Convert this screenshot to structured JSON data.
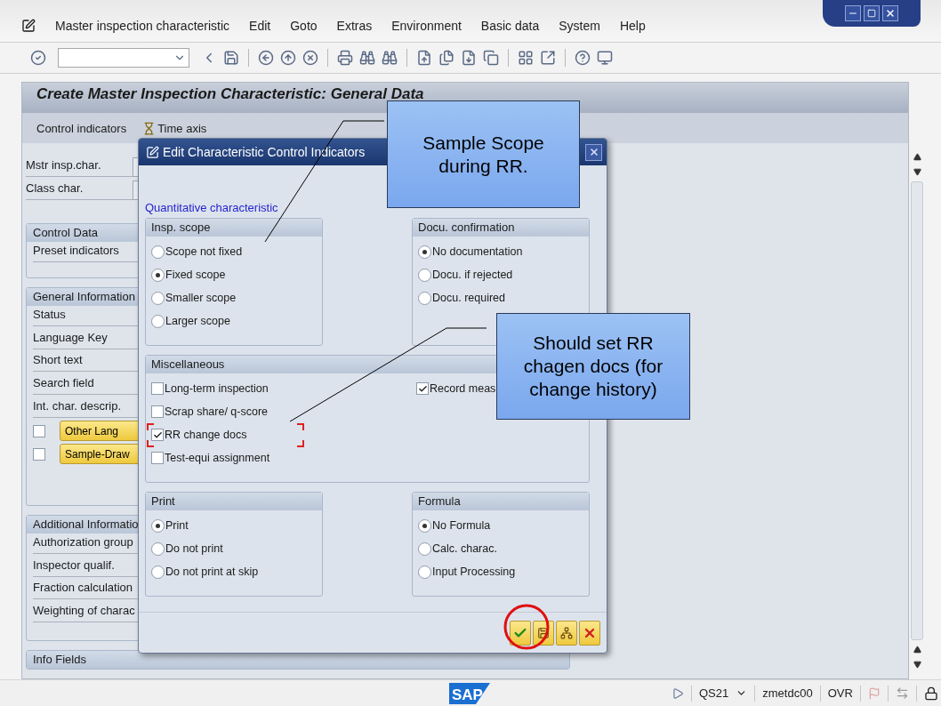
{
  "menu_bar": [
    "Master inspection characteristic",
    "Edit",
    "Goto",
    "Extras",
    "Environment",
    "Basic data",
    "System",
    "Help"
  ],
  "screen": {
    "title": "Create Master Inspection Characteristic: General Data",
    "app_toolbar": [
      {
        "label": "Control indicators",
        "kind": "text"
      },
      {
        "label": "Time axis",
        "kind": "icon"
      }
    ],
    "header_fields": [
      "Mstr insp.char.",
      "Class char."
    ],
    "groups": [
      {
        "title": "Control Data",
        "rows": [
          {
            "kind": "field",
            "label": "Preset indicators"
          }
        ]
      },
      {
        "title": "General Information",
        "rows": [
          {
            "kind": "field",
            "label": "Status"
          },
          {
            "kind": "field",
            "label": "Language Key"
          },
          {
            "kind": "field",
            "label": "Short text"
          },
          {
            "kind": "field",
            "label": "Search field"
          },
          {
            "kind": "field",
            "label": "Int. char. descrip."
          },
          {
            "kind": "button",
            "label": "Other Lang",
            "checked": false
          },
          {
            "kind": "button",
            "label": "Sample-Draw",
            "checked": false
          }
        ]
      },
      {
        "title": "Additional Informatio",
        "rows": [
          {
            "kind": "field",
            "label": "Authorization group"
          },
          {
            "kind": "field",
            "label": "Inspector qualif."
          },
          {
            "kind": "field",
            "label": "Fraction calculation"
          },
          {
            "kind": "field",
            "label": "Weighting of charac"
          }
        ]
      },
      {
        "title": "Info Fields"
      }
    ]
  },
  "dialog": {
    "title": "Edit Characteristic Control Indicators",
    "subtitle": "Quantitative characteristic",
    "rows": [
      [
        {
          "title": "Insp. scope",
          "kind": "radio",
          "options": [
            {
              "label": "Scope not fixed",
              "selected": false
            },
            {
              "label": "Fixed scope",
              "selected": true
            },
            {
              "label": "Smaller scope",
              "selected": false
            },
            {
              "label": "Larger scope",
              "selected": false
            }
          ]
        },
        {
          "title": "Docu. confirmation",
          "kind": "radio",
          "options": [
            {
              "label": "No documentation",
              "selected": true
            },
            {
              "label": "Docu. if rejected",
              "selected": false
            },
            {
              "label": "Docu. required",
              "selected": false
            }
          ]
        }
      ],
      [
        {
          "title": "Miscellaneous",
          "kind": "checkbox",
          "columns": [
            [
              {
                "label": "Long-term inspection",
                "checked": false
              },
              {
                "label": "Scrap share/ q-score",
                "checked": false
              },
              {
                "label": "RR change docs",
                "checked": true
              },
              {
                "label": "Test-equi assignment",
                "checked": false
              }
            ],
            [
              {
                "label": "Record meas",
                "checked": true
              }
            ]
          ]
        }
      ],
      [
        {
          "title": "Print",
          "kind": "radio",
          "options": [
            {
              "label": "Print",
              "selected": true
            },
            {
              "label": "Do not print",
              "selected": false
            },
            {
              "label": "Do not print at skip",
              "selected": false
            }
          ]
        },
        {
          "title": "Formula",
          "kind": "radio",
          "options": [
            {
              "label": "No Formula",
              "selected": true
            },
            {
              "label": "Calc. charac.",
              "selected": false
            },
            {
              "label": "Input Processing",
              "selected": false
            }
          ]
        }
      ]
    ]
  },
  "callouts": [
    {
      "text": "Sample Scope during RR."
    },
    {
      "text": "Should set RR chagen docs (for change history)"
    }
  ],
  "status_bar": {
    "logo": "SAP",
    "system": "QS21",
    "user": "zmetdc00",
    "mode": "OVR"
  }
}
